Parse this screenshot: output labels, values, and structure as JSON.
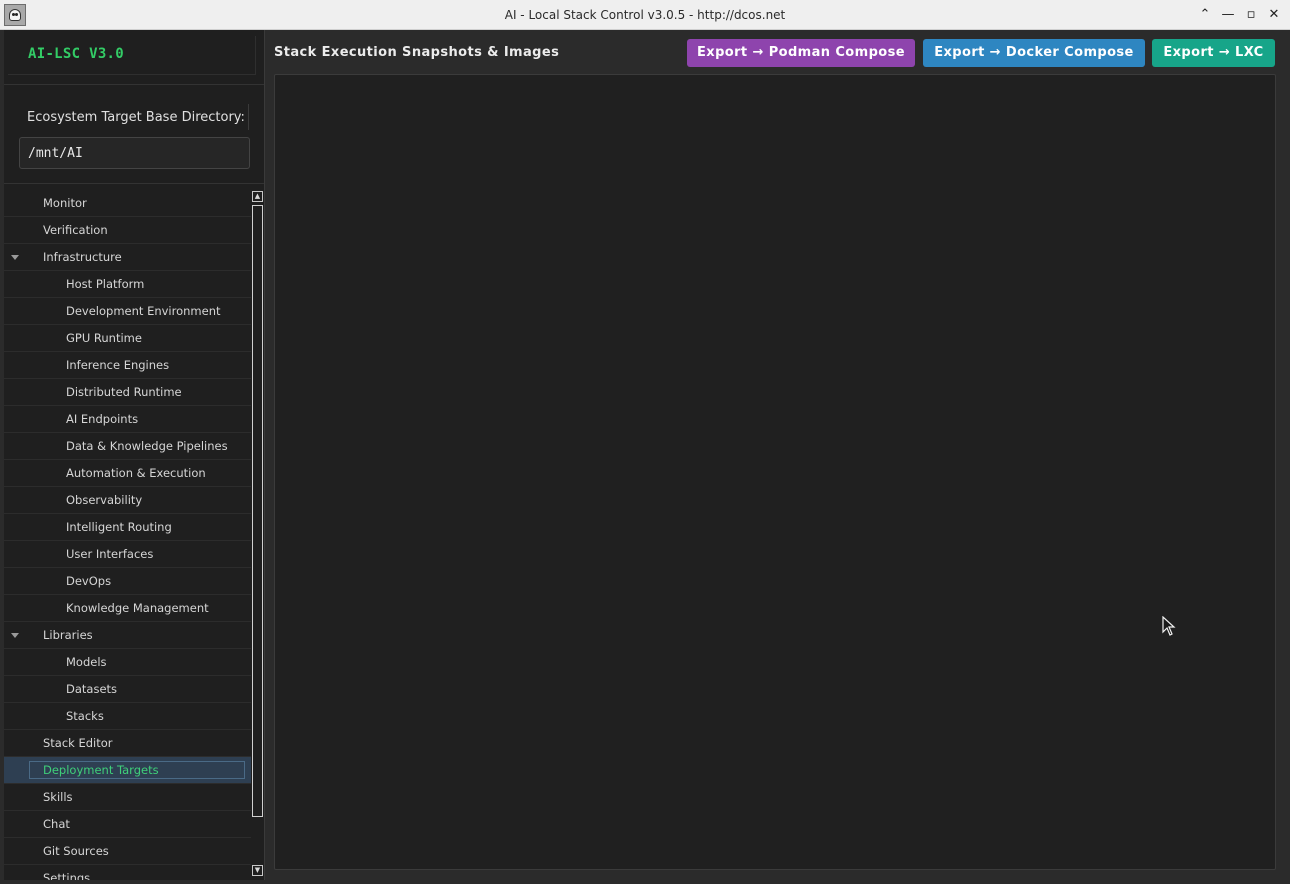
{
  "window": {
    "title": "AI - Local Stack Control v3.0.5 - http://dcos.net",
    "controls": {
      "collapse": "⌃",
      "minimize": "—",
      "maximize": "▫",
      "close": "✕"
    }
  },
  "sidebar": {
    "brand": "AI-LSC V3.0",
    "directory_label": "Ecosystem Target Base Directory:",
    "directory_value": "/mnt/AI",
    "tree": [
      {
        "label": "Monitor",
        "level": 0
      },
      {
        "label": "Verification",
        "level": 0
      },
      {
        "label": "Infrastructure",
        "level": 0,
        "expanded": true
      },
      {
        "label": "Host Platform",
        "level": 1
      },
      {
        "label": "Development Environment",
        "level": 1
      },
      {
        "label": "GPU Runtime",
        "level": 1
      },
      {
        "label": "Inference Engines",
        "level": 1
      },
      {
        "label": "Distributed Runtime",
        "level": 1
      },
      {
        "label": "AI Endpoints",
        "level": 1
      },
      {
        "label": "Data & Knowledge Pipelines",
        "level": 1
      },
      {
        "label": "Automation & Execution",
        "level": 1
      },
      {
        "label": "Observability",
        "level": 1
      },
      {
        "label": "Intelligent Routing",
        "level": 1
      },
      {
        "label": "User Interfaces",
        "level": 1
      },
      {
        "label": "DevOps",
        "level": 1
      },
      {
        "label": "Knowledge Management",
        "level": 1
      },
      {
        "label": "Libraries",
        "level": 0,
        "expanded": true
      },
      {
        "label": "Models",
        "level": 1
      },
      {
        "label": "Datasets",
        "level": 1
      },
      {
        "label": "Stacks",
        "level": 1
      },
      {
        "label": "Stack Editor",
        "level": 0
      },
      {
        "label": "Deployment Targets",
        "level": 0,
        "selected": true
      },
      {
        "label": "Skills",
        "level": 0
      },
      {
        "label": "Chat",
        "level": 0
      },
      {
        "label": "Git Sources",
        "level": 0
      },
      {
        "label": "Settings",
        "level": 0
      }
    ]
  },
  "main": {
    "title": "Stack Execution Snapshots & Images",
    "buttons": {
      "podman": "Export → Podman Compose",
      "docker": "Export → Docker Compose",
      "lxc": "Export → LXC"
    }
  },
  "colors": {
    "brand": "#33cc66",
    "selected_text": "#3fcf7a",
    "selected_bg": "#2e3f52",
    "podman_button": "#8e44ad",
    "docker_button": "#2e86c1",
    "lxc_button": "#17a589"
  }
}
